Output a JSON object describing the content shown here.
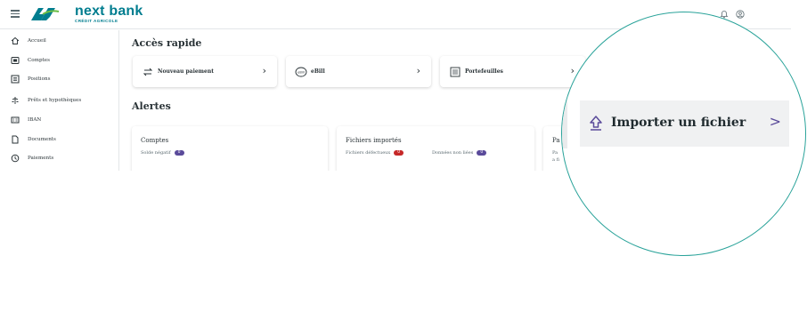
{
  "header": {
    "logo_main": "next bank",
    "logo_sub": "CRÉDIT AGRICOLE",
    "menu_icon": "hamburger-icon",
    "right_icons": [
      "bell-icon",
      "user-icon"
    ]
  },
  "sidebar": {
    "items": [
      {
        "label": "Accueil",
        "icon": "home-icon"
      },
      {
        "label": "Comptes",
        "icon": "accounts-icon"
      },
      {
        "label": "Positions",
        "icon": "positions-icon"
      },
      {
        "label": "Prêts et hypothèques",
        "icon": "loans-icon"
      },
      {
        "label": "IBAN",
        "icon": "iban-icon"
      },
      {
        "label": "Documents",
        "icon": "documents-icon"
      },
      {
        "label": "Paiements",
        "icon": "payments-icon"
      }
    ]
  },
  "main": {
    "quick_access_title": "Accès rapide",
    "quick_access": [
      {
        "label": "Nouveau paiement",
        "icon": "transfer-arrows-icon"
      },
      {
        "label": "eBill",
        "icon": "ebill-icon"
      },
      {
        "label": "Portefeuilles",
        "icon": "portfolio-icon"
      }
    ],
    "alerts_title": "Alertes",
    "alerts": [
      {
        "title": "Comptes",
        "rows": [
          {
            "label": "Solde négatif",
            "count": "0",
            "color": "#5a4a9a"
          }
        ]
      },
      {
        "title": "Fichiers importés",
        "rows": [
          {
            "label": "Fichiers défectueux",
            "count": "0",
            "color": "#c62828"
          },
          {
            "label": "Données non liées",
            "count": "0",
            "color": "#5a4a9a"
          }
        ]
      },
      {
        "title": "Pa",
        "rows": [
          {
            "label": "Pa",
            "count": "",
            "color": ""
          },
          {
            "label": "a fi",
            "count": "",
            "color": ""
          }
        ]
      }
    ]
  },
  "zoom_callout": {
    "label": "Importer un fichier",
    "icon": "upload-icon",
    "chevron": ">"
  },
  "colors": {
    "brand": "#007d8f",
    "accent": "#5a4a9a",
    "danger": "#c62828",
    "callout_border": "#2aa39a"
  }
}
